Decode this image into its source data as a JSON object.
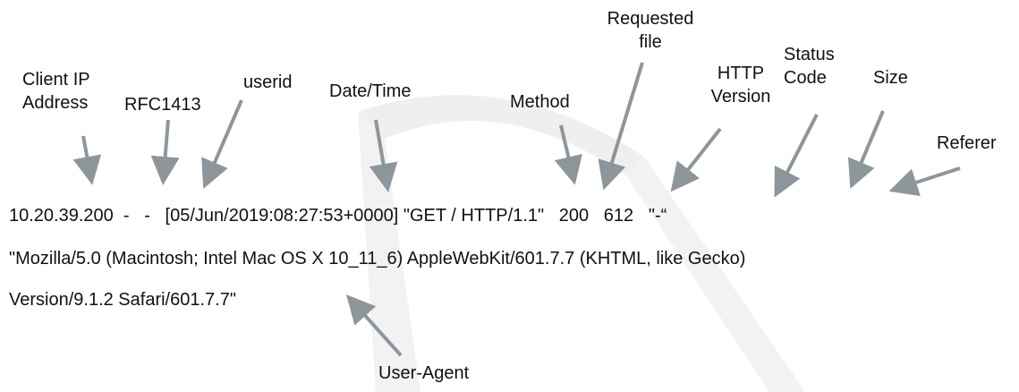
{
  "labels": {
    "client_ip": "Client IP\nAddress",
    "rfc1413": "RFC1413",
    "userid": "userid",
    "datetime": "Date/Time",
    "method": "Method",
    "requested_file": "Requested\nfile",
    "http_version": "HTTP\nVersion",
    "status_code": "Status\nCode",
    "size": "Size",
    "referer": "Referer",
    "user_agent": "User-Agent"
  },
  "log_lines": {
    "line1": "10.20.39.200  -   -   [05/Jun/2019:08:27:53+0000] \"GET / HTTP/1.1\"   200   612   \"-“",
    "line2": "\"Mozilla/5.0 (Macintosh; Intel Mac OS X 10_11_6) AppleWebKit/601.7.7 (KHTML, like Gecko)",
    "line3": "Version/9.1.2 Safari/601.7.7\""
  },
  "colors": {
    "text": "#111111",
    "arrow": "#8c969b",
    "watermark": "#eeeeee"
  }
}
